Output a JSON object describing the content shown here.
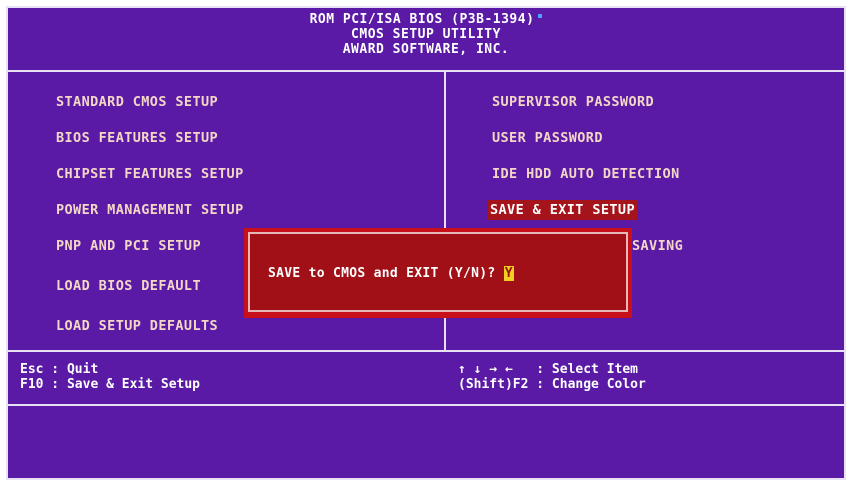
{
  "header": {
    "line1": "ROM PCI/ISA BIOS (P3B-1394)",
    "line2": "CMOS SETUP UTILITY",
    "line3": "AWARD SOFTWARE, INC."
  },
  "menu": {
    "left": [
      "STANDARD CMOS SETUP",
      "BIOS FEATURES SETUP",
      "CHIPSET FEATURES SETUP",
      "POWER MANAGEMENT SETUP",
      "PNP AND PCI SETUP",
      "LOAD BIOS DEFAULT",
      "LOAD SETUP DEFAULTS"
    ],
    "right": [
      "SUPERVISOR PASSWORD",
      "USER PASSWORD",
      "IDE HDD AUTO DETECTION",
      "SAVE & EXIT SETUP",
      "SAVING"
    ],
    "selected": "SAVE & EXIT SETUP"
  },
  "dialog": {
    "prompt": "SAVE to CMOS and EXIT (Y/N)? ",
    "answer": "Y"
  },
  "footer": {
    "left_line1": "Esc : Quit",
    "left_line2": "F10 : Save & Exit Setup",
    "right_line1": "↑ ↓ → ←   : Select Item",
    "right_line2": "(Shift)F2 : Change Color"
  },
  "colors": {
    "background": "#5a1aa6",
    "menu_text": "#f2d6c6",
    "highlight": "#a4141a",
    "dialog": "#c8101a"
  }
}
